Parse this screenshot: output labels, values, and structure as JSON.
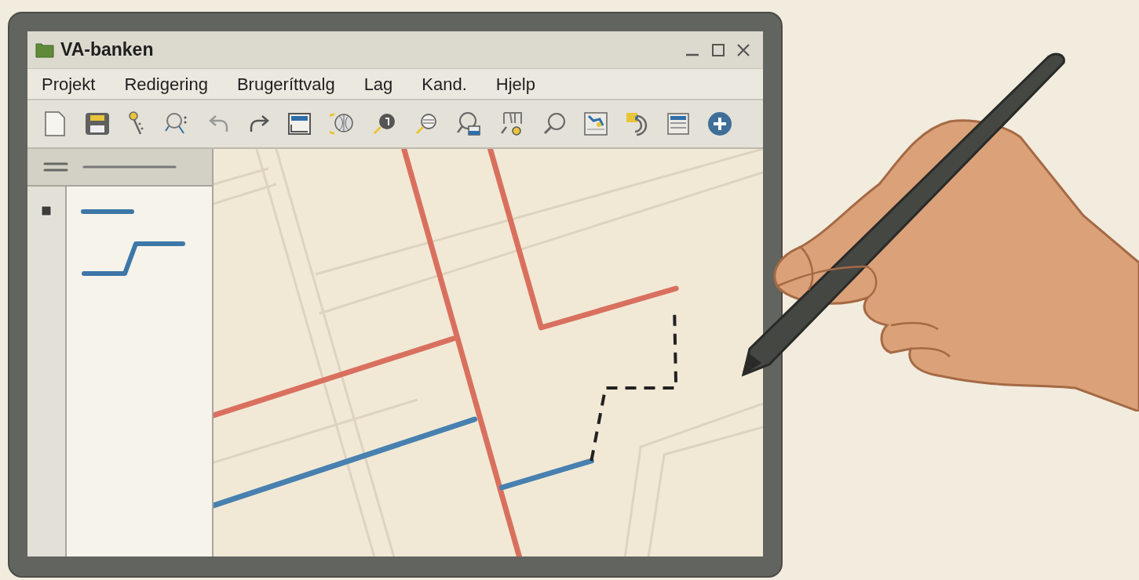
{
  "window": {
    "title": "VA-banken"
  },
  "menu": [
    "Projekt",
    "Redigering",
    "Brugeríttvalg",
    "Lag",
    "Kand.",
    "Hjelp"
  ]
}
